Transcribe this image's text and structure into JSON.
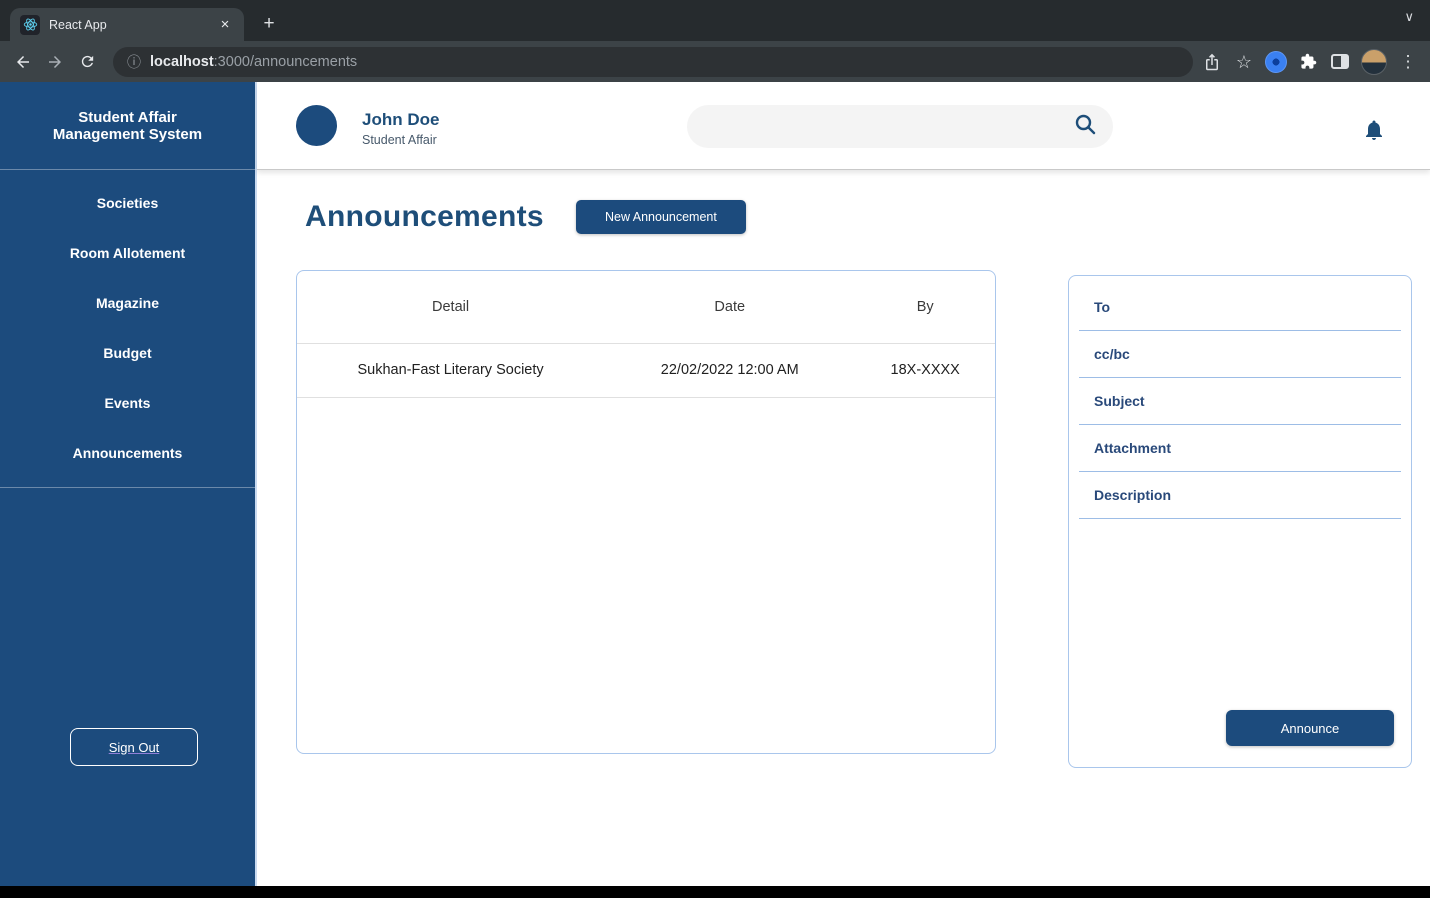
{
  "browser": {
    "tab_title": "React App",
    "url_host": "localhost",
    "url_rest": ":3000/announcements",
    "glyphs": {
      "close_tab": "×",
      "new_tab": "+",
      "tabs_chevron": "∨",
      "bookmark_star": "☆",
      "info": "ⓘ",
      "menu_dots": "⋮"
    }
  },
  "sidebar": {
    "title_line1": "Student Affair",
    "title_line2": "Management System",
    "items": [
      {
        "label": "Societies"
      },
      {
        "label": "Room Allotement"
      },
      {
        "label": "Magazine"
      },
      {
        "label": "Budget"
      },
      {
        "label": "Events"
      },
      {
        "label": "Announcements"
      }
    ],
    "sign_out_label": "Sign Out"
  },
  "header": {
    "user_name": "John Doe",
    "user_role": "Student Affair",
    "search_placeholder": ""
  },
  "main": {
    "title": "Announcements",
    "new_announcement_label": "New Announcement",
    "table": {
      "columns": [
        "Detail",
        "Date",
        "By"
      ],
      "rows": [
        [
          "Sukhan-Fast Literary Society",
          "22/02/2022 12:00 AM",
          "18X-XXXX"
        ]
      ]
    }
  },
  "compose": {
    "fields": [
      {
        "label": "To"
      },
      {
        "label": "cc/bc"
      },
      {
        "label": "Subject"
      },
      {
        "label": "Attachment"
      },
      {
        "label": "Description"
      }
    ],
    "announce_label": "Announce"
  },
  "colors": {
    "navy": "#1c4b7d",
    "heading_blue": "#1e4e79",
    "card_border": "#a9c6ec",
    "field_underline": "#9dbde6",
    "chrome_dark": "#262b2e",
    "chrome_toolbar": "#3c4347"
  }
}
